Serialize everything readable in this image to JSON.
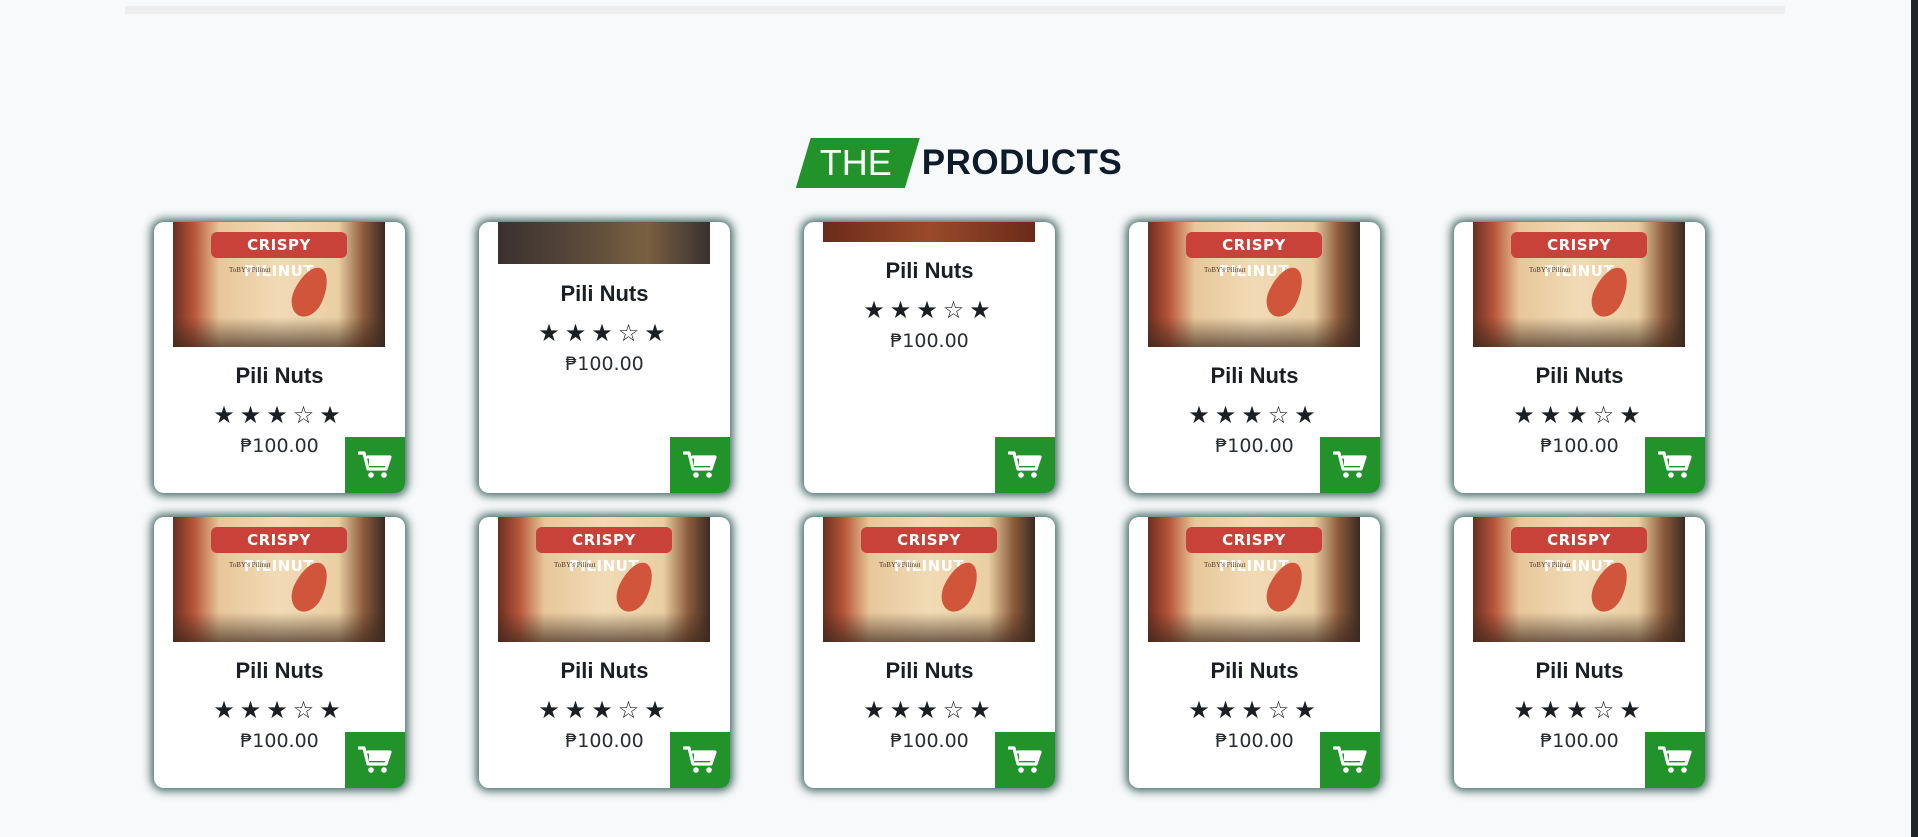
{
  "section": {
    "heading_tag": "THE",
    "heading_word": "PRODUCTS"
  },
  "thumbnail": {
    "label_text": "CRISPY PILINUT",
    "fine_print": "ToBY's Pilinut"
  },
  "products": [
    {
      "name": "Pili Nuts",
      "price": "₱100.00",
      "rating": 3,
      "stars": "★★★☆★",
      "layout": "full"
    },
    {
      "name": "Pili Nuts",
      "price": "₱100.00",
      "rating": 3,
      "stars": "★★★☆★",
      "layout": "partial-a"
    },
    {
      "name": "Pili Nuts",
      "price": "₱100.00",
      "rating": 3,
      "stars": "★★★☆★",
      "layout": "partial-b"
    },
    {
      "name": "Pili Nuts",
      "price": "₱100.00",
      "rating": 3,
      "stars": "★★★☆★",
      "layout": "full"
    },
    {
      "name": "Pili Nuts",
      "price": "₱100.00",
      "rating": 3,
      "stars": "★★★☆★",
      "layout": "full"
    },
    {
      "name": "Pili Nuts",
      "price": "₱100.00",
      "rating": 3,
      "stars": "★★★☆★",
      "layout": "full"
    },
    {
      "name": "Pili Nuts",
      "price": "₱100.00",
      "rating": 3,
      "stars": "★★★☆★",
      "layout": "full"
    },
    {
      "name": "Pili Nuts",
      "price": "₱100.00",
      "rating": 3,
      "stars": "★★★☆★",
      "layout": "full"
    },
    {
      "name": "Pili Nuts",
      "price": "₱100.00",
      "rating": 3,
      "stars": "★★★☆★",
      "layout": "full"
    },
    {
      "name": "Pili Nuts",
      "price": "₱100.00",
      "rating": 3,
      "stars": "★★★☆★",
      "layout": "full"
    }
  ],
  "icons": {
    "cart": "shopping-cart-icon"
  },
  "colors": {
    "accent_green": "#22922a",
    "heading_dark": "#0d1b2a",
    "card_shadow": "#204e46"
  }
}
